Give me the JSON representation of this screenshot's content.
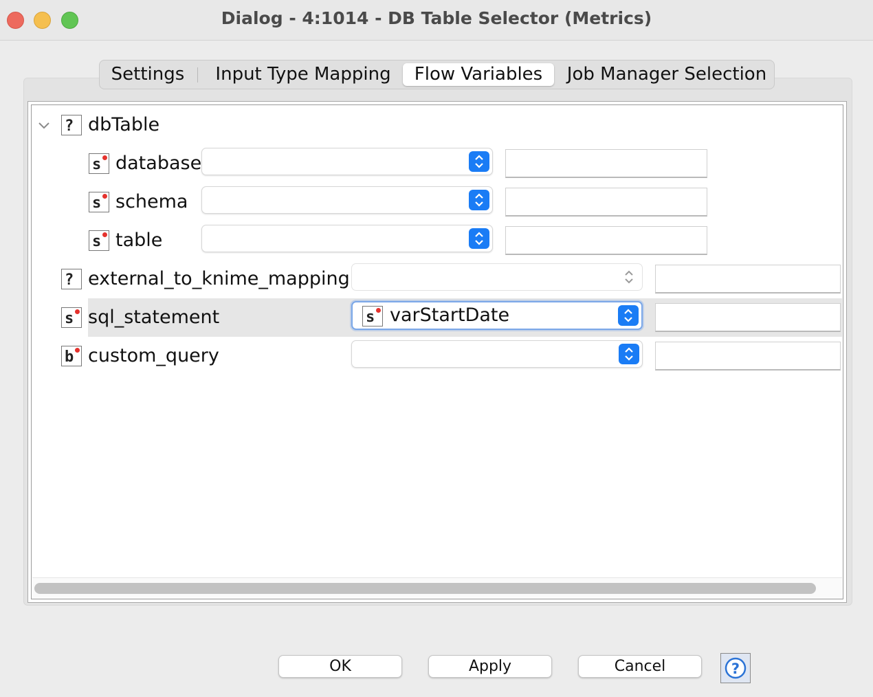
{
  "window": {
    "title": "Dialog - 4:1014 - DB Table Selector (Metrics)"
  },
  "tabs": [
    {
      "label": "Settings",
      "selected": false
    },
    {
      "label": "Input Type Mapping",
      "selected": false
    },
    {
      "label": "Flow Variables",
      "selected": true
    },
    {
      "label": "Job Manager Selection",
      "selected": false
    }
  ],
  "tree": {
    "root": {
      "label": "dbTable",
      "type_icon": "?",
      "expanded": true
    },
    "children": [
      {
        "label": "database",
        "type_icon": "s",
        "variable": "",
        "value": ""
      },
      {
        "label": "schema",
        "type_icon": "s",
        "variable": "",
        "value": ""
      },
      {
        "label": "table",
        "type_icon": "s",
        "variable": "",
        "value": ""
      }
    ],
    "rows": [
      {
        "label": "external_to_knime_mapping",
        "type_icon": "?",
        "variable": "",
        "enabled": false,
        "value": ""
      },
      {
        "label": "sql_statement",
        "type_icon": "s",
        "variable": "varStartDate",
        "variable_type_icon": "s",
        "selected": true,
        "value": ""
      },
      {
        "label": "custom_query",
        "type_icon": "b",
        "variable": "",
        "value": ""
      }
    ]
  },
  "footer": {
    "ok": "OK",
    "apply": "Apply",
    "cancel": "Cancel",
    "help_icon": "question-circle-icon"
  },
  "colors": {
    "accent": "#1a7cf5",
    "close": "#ed6a5e",
    "minimize": "#f5bf4f",
    "maximize": "#61c554",
    "variable_dot": "#e5322d"
  }
}
